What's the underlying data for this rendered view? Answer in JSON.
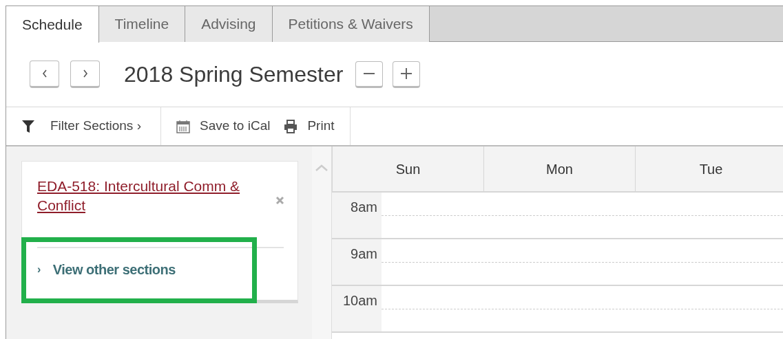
{
  "tabs": [
    {
      "label": "Schedule",
      "selected": true
    },
    {
      "label": "Timeline",
      "selected": false
    },
    {
      "label": "Advising",
      "selected": false
    },
    {
      "label": "Petitions & Waivers",
      "selected": false
    }
  ],
  "header": {
    "title": "2018 Spring Semester"
  },
  "toolbar": [
    {
      "kind": "filter",
      "label": "Filter Sections",
      "chevron": "›"
    },
    {
      "kind": "calendar",
      "label": "Save to iCal"
    },
    {
      "kind": "print",
      "label": "Print"
    }
  ],
  "course_card": {
    "title": "EDA-518: Intercultural Comm & Conflict",
    "link": "View other sections",
    "chevron": "›",
    "highlighted": true
  },
  "calendar": {
    "days": [
      "Sun",
      "Mon",
      "Tue"
    ],
    "hours": [
      "8am",
      "9am",
      "10am"
    ]
  }
}
